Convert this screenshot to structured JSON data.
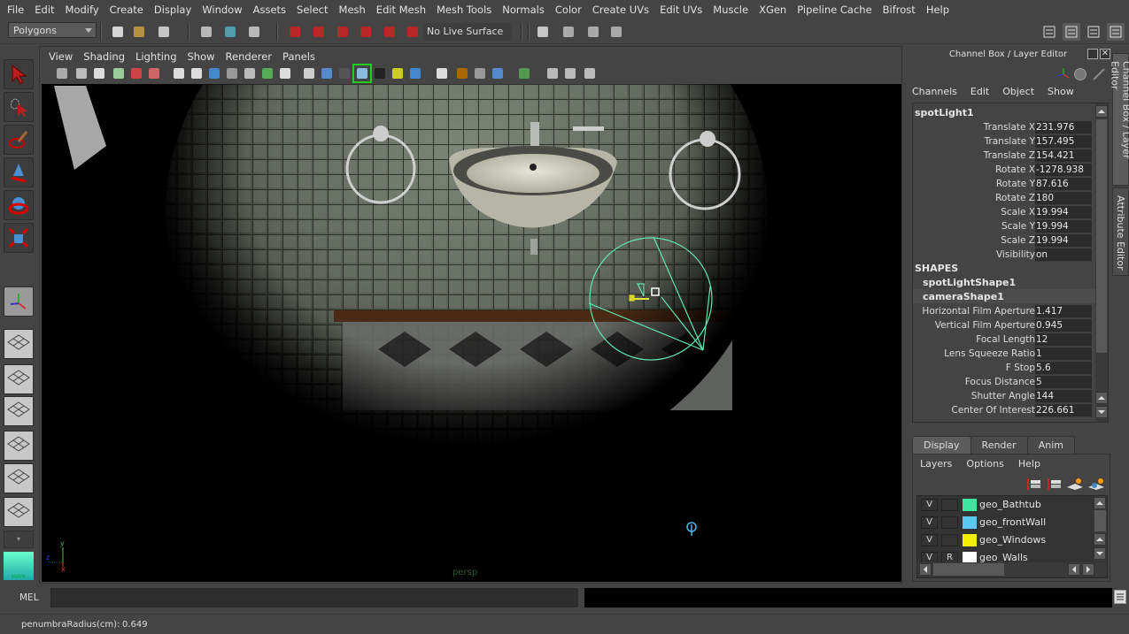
{
  "menubar": [
    "File",
    "Edit",
    "Modify",
    "Create",
    "Display",
    "Window",
    "Assets",
    "Select",
    "Mesh",
    "Edit Mesh",
    "Mesh Tools",
    "Normals",
    "Color",
    "Create UVs",
    "Edit UVs",
    "Muscle",
    "XGen",
    "Pipeline Cache",
    "Bifrost",
    "Help"
  ],
  "toolbar": {
    "mode_selector": "Polygons",
    "live_surface": "No Live Surface",
    "icons": [
      "new-scene-icon",
      "open-scene-icon",
      "save-scene-icon",
      "select-by-hierarchy-icon",
      "select-by-object-icon",
      "select-by-component-icon",
      "snap-to-grid-icon",
      "snap-to-curve-icon",
      "snap-to-point-icon",
      "snap-to-projected-center-icon",
      "snap-to-view-plane-icon",
      "make-live-icon",
      "render-settings-icon",
      "render-current-frame-icon",
      "ipr-render-icon",
      "hypershade-icon"
    ],
    "right_icons": [
      "modeling-toolkit-icon",
      "attribute-editor-toggle-icon",
      "tool-settings-icon",
      "channel-box-toggle-icon"
    ]
  },
  "toolbox": {
    "tools": [
      "select-tool-icon",
      "lasso-tool-icon",
      "paint-select-tool-icon",
      "move-tool-icon",
      "rotate-tool-icon",
      "scale-tool-icon",
      "universal-manipulator-icon"
    ],
    "layouts": [
      "single-perspective-layout-icon",
      "four-view-layout-icon",
      "outliner-persp-layout-icon",
      "hypershade-persp-layout-icon",
      "render-view-persp-layout-icon",
      "persp-graph-layout-icon"
    ],
    "logo": "MAYA"
  },
  "viewport": {
    "menu": [
      "View",
      "Shading",
      "Lighting",
      "Show",
      "Renderer",
      "Panels"
    ],
    "camera_label": "persp",
    "axis": {
      "y": "y",
      "x": "x",
      "z": "z"
    }
  },
  "channel_box": {
    "title": "Channel Box / Layer Editor",
    "menu": [
      "Channels",
      "Edit",
      "Object",
      "Show"
    ],
    "object_name": "spotLight1",
    "attributes": [
      {
        "label": "Translate X",
        "value": "231.976"
      },
      {
        "label": "Translate Y",
        "value": "157.495"
      },
      {
        "label": "Translate Z",
        "value": "154.421"
      },
      {
        "label": "Rotate X",
        "value": "-1278.938"
      },
      {
        "label": "Rotate Y",
        "value": "87.616"
      },
      {
        "label": "Rotate Z",
        "value": "180"
      },
      {
        "label": "Scale X",
        "value": "19.994"
      },
      {
        "label": "Scale Y",
        "value": "19.994"
      },
      {
        "label": "Scale Z",
        "value": "19.994"
      },
      {
        "label": "Visibility",
        "value": "on"
      }
    ],
    "shapes_header": "SHAPES",
    "shape_nodes": [
      "spotLightShape1",
      "cameraShape1"
    ],
    "shape_attributes": [
      {
        "label": "Horizontal Film Aperture",
        "value": "1.417"
      },
      {
        "label": "Vertical Film Aperture",
        "value": "0.945"
      },
      {
        "label": "Focal Length",
        "value": "12"
      },
      {
        "label": "Lens Squeeze Ratio",
        "value": "1"
      },
      {
        "label": "F Stop",
        "value": "5.6"
      },
      {
        "label": "Focus Distance",
        "value": "5"
      },
      {
        "label": "Shutter Angle",
        "value": "144"
      },
      {
        "label": "Center Of Interest",
        "value": "226.661"
      }
    ]
  },
  "side_tabs": [
    "Channel Box / Layer Editor",
    "Attribute Editor"
  ],
  "layer_editor": {
    "tabs": [
      "Display",
      "Render",
      "Anim"
    ],
    "active_tab": "Display",
    "menu": [
      "Layers",
      "Options",
      "Help"
    ],
    "layers": [
      {
        "v": "V",
        "r": "",
        "color": "#3ee6a0",
        "name": "geo_Bathtub"
      },
      {
        "v": "V",
        "r": "",
        "color": "#5ac8f0",
        "name": "geo_frontWall"
      },
      {
        "v": "V",
        "r": "",
        "color": "#f0f000",
        "name": "geo_Windows"
      },
      {
        "v": "V",
        "r": "R",
        "color": "#ffffff",
        "name": "geo_Walls"
      }
    ]
  },
  "command_line": {
    "label": "MEL",
    "input": "",
    "result": ""
  },
  "help_line": {
    "label": "penumbraRadius(cm):",
    "value": "0.649"
  }
}
